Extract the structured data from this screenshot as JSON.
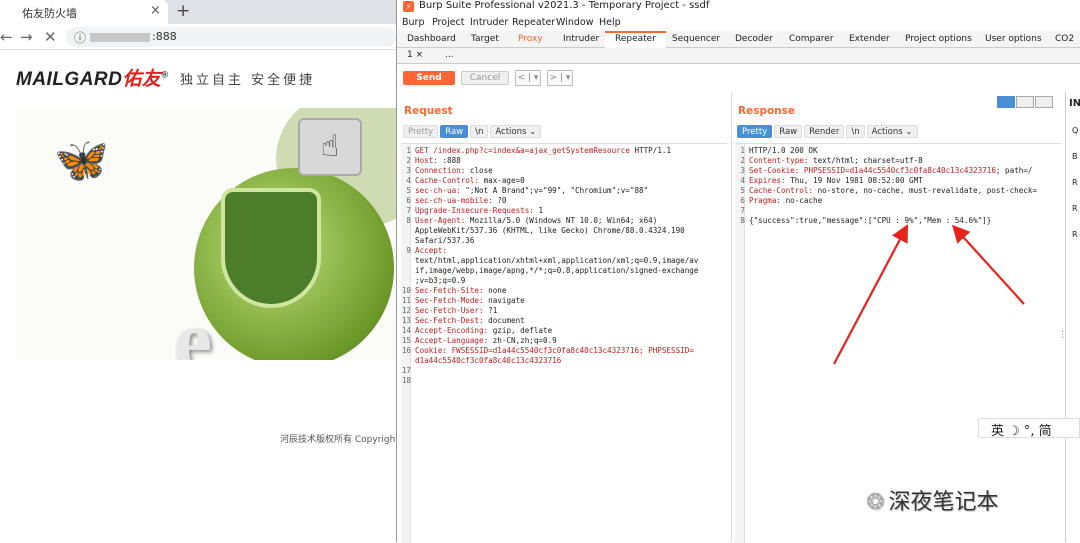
{
  "browser": {
    "tab_title": "佑友防火墙",
    "tab_close": "×",
    "new_tab": "+",
    "back": "←",
    "forward": "→",
    "reload": "✕",
    "info_icon": "ⓘ",
    "url_visible": ":888",
    "logo_prefix": "MAILGARD",
    "logo_brand": "佑友",
    "logo_reg": "®",
    "slogan": "独立自主 安全便捷",
    "copyright": "河辰技术版权所有 Copyright ©"
  },
  "burp": {
    "title": "Burp Suite Professional v2021.3 - Temporary Project - ssdf",
    "menu": [
      "Burp",
      "Project",
      "Intruder",
      "Repeater",
      "Window",
      "Help"
    ],
    "tabs": [
      "Dashboard",
      "Target",
      "Proxy",
      "Intruder",
      "Repeater",
      "Sequencer",
      "Decoder",
      "Comparer",
      "Extender",
      "Project options",
      "User options",
      "CO2"
    ],
    "active_tab": "Repeater",
    "subtab_1": "1 ×",
    "subtab_more": "...",
    "send": "Send",
    "cancel": "Cancel",
    "hist_back": "< | ▾",
    "hist_fwd": "> | ▾",
    "request": {
      "title": "Request",
      "buttons": [
        "Pretty",
        "Raw",
        "\\n",
        "Actions ⌄"
      ],
      "active_button": "Raw",
      "lines": [
        {
          "n": "1",
          "k": "GET /index.php?c=",
          "v": "index&a=ajax_getSystemResource",
          "rest": " HTTP/1.1"
        },
        {
          "n": "2",
          "k": "Host: ",
          "v": "",
          "rest": ":888"
        },
        {
          "n": "3",
          "k": "Connection: ",
          "v": "",
          "rest": "close"
        },
        {
          "n": "4",
          "k": "Cache-Control: ",
          "v": "",
          "rest": "max-age=0"
        },
        {
          "n": "5",
          "k": "sec-ch-ua: ",
          "v": "",
          "rest": "\";Not A Brand\";v=\"99\", \"Chromium\";v=\"88\""
        },
        {
          "n": "6",
          "k": "sec-ch-ua-mobile: ",
          "v": "",
          "rest": "?0"
        },
        {
          "n": "7",
          "k": "Upgrade-Insecure-Requests: ",
          "v": "",
          "rest": "1"
        },
        {
          "n": "8",
          "k": "User-Agent: ",
          "v": "",
          "rest": "Mozilla/5.0 (Windows NT 10.0; Win64; x64)"
        },
        {
          "n": "",
          "k": "",
          "v": "",
          "rest": "AppleWebKit/537.36 (KHTML, like Gecko) Chrome/88.0.4324.190"
        },
        {
          "n": "",
          "k": "",
          "v": "",
          "rest": "Safari/537.36"
        },
        {
          "n": "9",
          "k": "Accept:",
          "v": "",
          "rest": ""
        },
        {
          "n": "",
          "k": "",
          "v": "",
          "rest": "text/html,application/xhtml+xml,application/xml;q=0.9,image/av"
        },
        {
          "n": "",
          "k": "",
          "v": "",
          "rest": "if,image/webp,image/apng,*/*;q=0.8,application/signed-exchange"
        },
        {
          "n": "",
          "k": "",
          "v": "",
          "rest": ";v=b3;q=0.9"
        },
        {
          "n": "10",
          "k": "Sec-Fetch-Site: ",
          "v": "",
          "rest": "none"
        },
        {
          "n": "11",
          "k": "Sec-Fetch-Mode: ",
          "v": "",
          "rest": "navigate"
        },
        {
          "n": "12",
          "k": "Sec-Fetch-User: ",
          "v": "",
          "rest": "?1"
        },
        {
          "n": "13",
          "k": "Sec-Fetch-Dest: ",
          "v": "",
          "rest": "document"
        },
        {
          "n": "14",
          "k": "Accept-Encoding: ",
          "v": "",
          "rest": "gzip, deflate"
        },
        {
          "n": "15",
          "k": "Accept-Language: ",
          "v": "",
          "rest": "zh-CN,zh;q=0.9"
        },
        {
          "n": "16",
          "k": "Cookie: ",
          "v": "FWSESSID=d1a44c5540cf3c0fa8c40c13c4323716; PHPSESSID=",
          "rest": ""
        },
        {
          "n": "",
          "k": "",
          "v": "d1a44c5540cf3c0fa8c40c13c4323716",
          "rest": ""
        },
        {
          "n": "17",
          "k": "",
          "v": "",
          "rest": ""
        },
        {
          "n": "18",
          "k": "",
          "v": "",
          "rest": ""
        }
      ]
    },
    "response": {
      "title": "Response",
      "buttons": [
        "Pretty",
        "Raw",
        "Render",
        "\\n",
        "Actions ⌄"
      ],
      "active_button": "Pretty",
      "lines": [
        {
          "n": "1",
          "k": "",
          "v": "",
          "rest": "HTTP/1.0 200 OK"
        },
        {
          "n": "2",
          "k": "Content-type: ",
          "v": "",
          "rest": "text/html; charset=utf-8"
        },
        {
          "n": "3",
          "k": "Set-Cookie: ",
          "v": "PHPSESSID=d1a44c5540cf3c0fa8c40c13c4323716",
          "rest": "; path=/"
        },
        {
          "n": "4",
          "k": "Expires: ",
          "v": "",
          "rest": "Thu, 19 Nov 1981 08:52:00 GMT"
        },
        {
          "n": "5",
          "k": "Cache-Control: ",
          "v": "",
          "rest": "no-store, no-cache, must-revalidate, post-check="
        },
        {
          "n": "6",
          "k": "Pragma: ",
          "v": "",
          "rest": "no-cache"
        },
        {
          "n": "7",
          "k": "",
          "v": "",
          "rest": ""
        },
        {
          "n": "8",
          "k": "",
          "v": "",
          "rest": "{\"success\":true,\"message\":[\"CPU : 9%\",\"Mem : 54.6%\"]}"
        }
      ]
    },
    "inspector_title": "IN",
    "inspector_rows": [
      "Q",
      "B",
      "R",
      "R",
      "R"
    ],
    "scroll_marker": "⋮"
  },
  "ime": "英 ☽ °, 简",
  "watermark": "深夜笔记本",
  "colors": {
    "accent": "#ff6633",
    "button_blue": "#4a8fd4",
    "arrow_red": "#e8231c"
  }
}
